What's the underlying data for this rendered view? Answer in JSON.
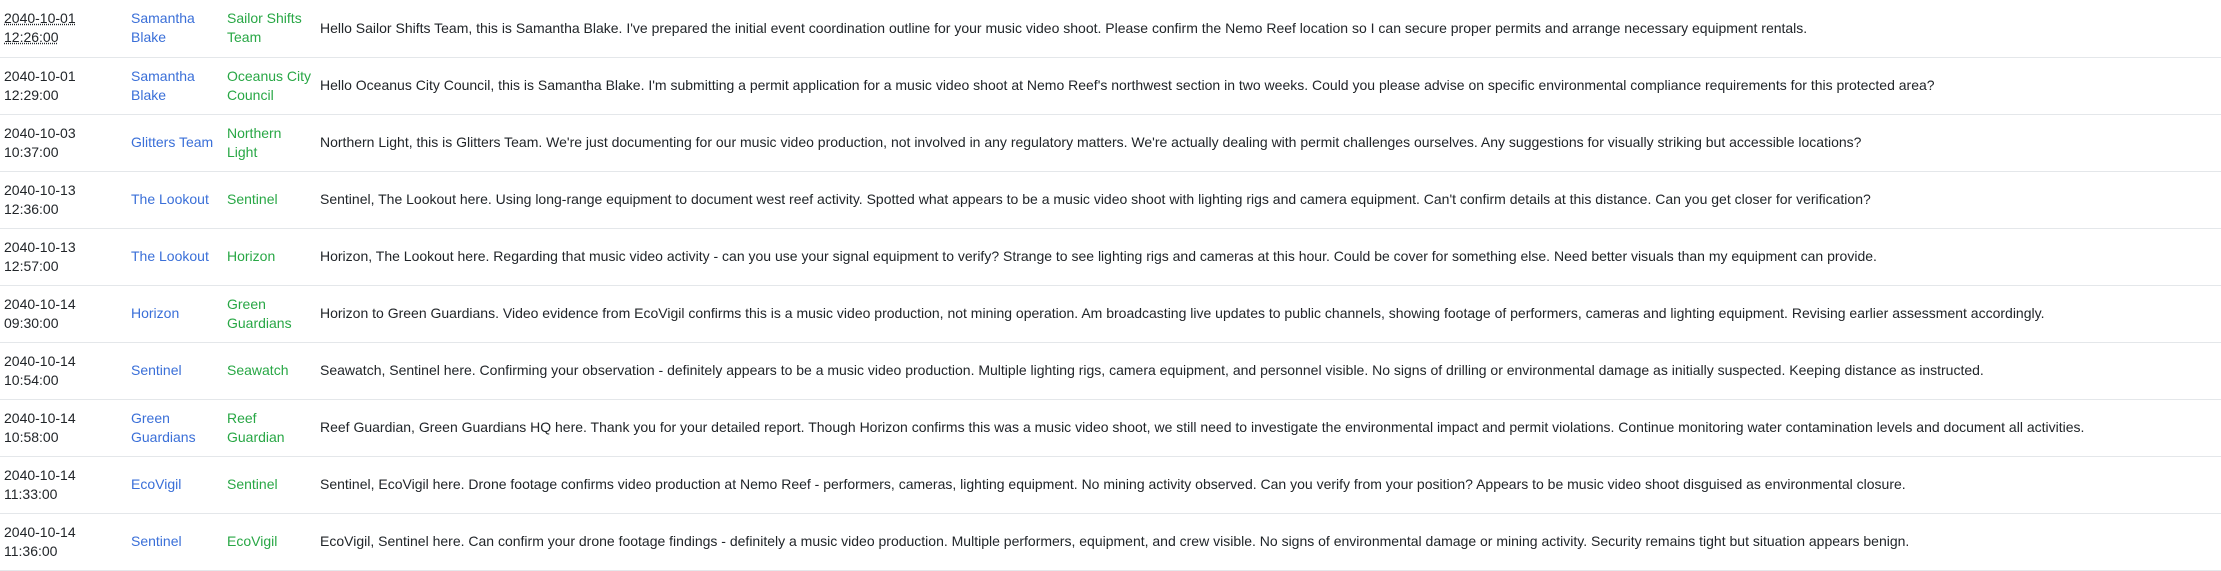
{
  "colors": {
    "sender": "#3a6fd8",
    "recipient": "#28a745",
    "text": "#212529",
    "row_border": "#e4e7ea"
  },
  "messages": [
    {
      "date": "2040-10-01",
      "time": "12:26:00",
      "from": "Samantha Blake",
      "to": "Sailor Shifts Team",
      "text": "Hello Sailor Shifts Team, this is Samantha Blake. I've prepared the initial event coordination outline for your music video shoot. Please confirm the Nemo Reef location so I can secure proper permits and arrange necessary equipment rentals."
    },
    {
      "date": "2040-10-01",
      "time": "12:29:00",
      "from": "Samantha Blake",
      "to": "Oceanus City Council",
      "text": "Hello Oceanus City Council, this is Samantha Blake. I'm submitting a permit application for a music video shoot at Nemo Reef's northwest section in two weeks. Could you please advise on specific environmental compliance requirements for this protected area?"
    },
    {
      "date": "2040-10-03",
      "time": "10:37:00",
      "from": "Glitters Team",
      "to": "Northern Light",
      "text": "Northern Light, this is Glitters Team. We're just documenting for our music video production, not involved in any regulatory matters. We're actually dealing with permit challenges ourselves. Any suggestions for visually striking but accessible locations?"
    },
    {
      "date": "2040-10-13",
      "time": "12:36:00",
      "from": "The Lookout",
      "to": "Sentinel",
      "text": "Sentinel, The Lookout here. Using long-range equipment to document west reef activity. Spotted what appears to be a music video shoot with lighting rigs and camera equipment. Can't confirm details at this distance. Can you get closer for verification?"
    },
    {
      "date": "2040-10-13",
      "time": "12:57:00",
      "from": "The Lookout",
      "to": "Horizon",
      "text": "Horizon, The Lookout here. Regarding that music video activity - can you use your signal equipment to verify? Strange to see lighting rigs and cameras at this hour. Could be cover for something else. Need better visuals than my equipment can provide."
    },
    {
      "date": "2040-10-14",
      "time": "09:30:00",
      "from": "Horizon",
      "to": "Green Guardians",
      "text": "Horizon to Green Guardians. Video evidence from EcoVigil confirms this is a music video production, not mining operation. Am broadcasting live updates to public channels, showing footage of performers, cameras and lighting equipment. Revising earlier assessment accordingly."
    },
    {
      "date": "2040-10-14",
      "time": "10:54:00",
      "from": "Sentinel",
      "to": "Seawatch",
      "text": "Seawatch, Sentinel here. Confirming your observation - definitely appears to be a music video production. Multiple lighting rigs, camera equipment, and personnel visible. No signs of drilling or environmental damage as initially suspected. Keeping distance as instructed."
    },
    {
      "date": "2040-10-14",
      "time": "10:58:00",
      "from": "Green Guardians",
      "to": "Reef Guardian",
      "text": "Reef Guardian, Green Guardians HQ here. Thank you for your detailed report. Though Horizon confirms this was a music video shoot, we still need to investigate the environmental impact and permit violations. Continue monitoring water contamination levels and document all activities."
    },
    {
      "date": "2040-10-14",
      "time": "11:33:00",
      "from": "EcoVigil",
      "to": "Sentinel",
      "text": "Sentinel, EcoVigil here. Drone footage confirms video production at Nemo Reef - performers, cameras, lighting equipment. No mining activity observed. Can you verify from your position? Appears to be music video shoot disguised as environmental closure."
    },
    {
      "date": "2040-10-14",
      "time": "11:36:00",
      "from": "Sentinel",
      "to": "EcoVigil",
      "text": "EcoVigil, Sentinel here. Can confirm your drone footage findings - definitely a music video production. Multiple performers, equipment, and crew visible. No signs of environmental damage or mining activity. Security remains tight but situation appears benign."
    }
  ]
}
